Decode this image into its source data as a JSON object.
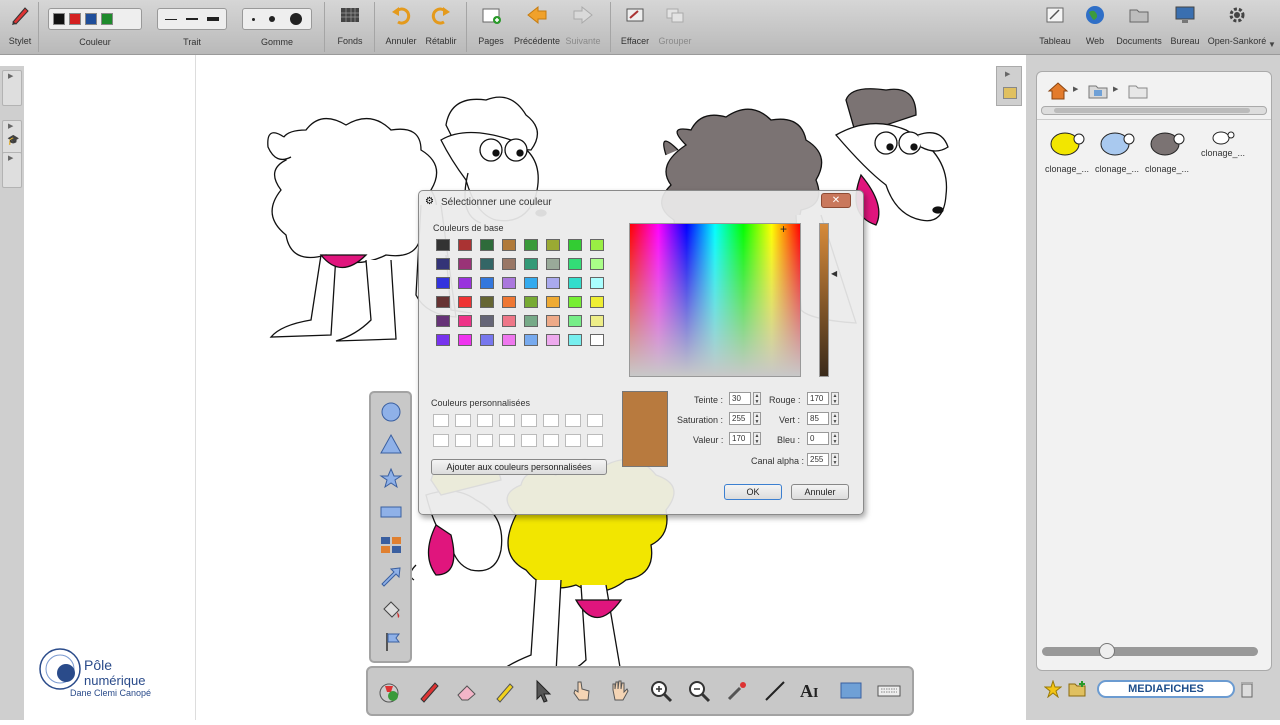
{
  "toolbar": {
    "stylet": "Stylet",
    "couleur": "Couleur",
    "trait": "Trait",
    "gomme": "Gomme",
    "fonds": "Fonds",
    "annuler": "Annuler",
    "retablir": "Rétablir",
    "pages": "Pages",
    "precedente": "Précédente",
    "suivante": "Suivante",
    "effacer": "Effacer",
    "grouper": "Grouper",
    "tableau": "Tableau",
    "web": "Web",
    "documents": "Documents",
    "bureau": "Bureau",
    "open_sankore": "Open-Sankoré",
    "colors": [
      "#111111",
      "#d42020",
      "#1f4e9a",
      "#1e8a2c"
    ]
  },
  "library": {
    "items": [
      {
        "label": "clonage_...",
        "color": "#f2e600"
      },
      {
        "label": "clonage_...",
        "color": "#a9c9ef"
      },
      {
        "label": "clonage_...",
        "color": "#7b7373"
      },
      {
        "label": "clonage_...",
        "color": "#ffffff"
      }
    ],
    "mediafiches": "MEDIAFICHES"
  },
  "dialog": {
    "title": "Sélectionner une couleur",
    "basic_colors_label": "Couleurs de base",
    "custom_colors_label": "Couleurs personnalisées",
    "add_custom_button": "Ajouter aux couleurs personnalisées",
    "hue_label": "Teinte :",
    "hue": "30",
    "saturation_label": "Saturation :",
    "saturation": "255",
    "value_label": "Valeur :",
    "value": "170",
    "red_label": "Rouge :",
    "red": "170",
    "green_label": "Vert :",
    "green": "85",
    "blue_label": "Bleu :",
    "blue": "0",
    "alpha_label": "Canal alpha :",
    "alpha": "255",
    "ok_button": "OK",
    "cancel_button": "Annuler",
    "current_color": "#b87a3e",
    "basic_colors": [
      "#333333",
      "#aa3333",
      "#2e6b3a",
      "#b07a3a",
      "#3a9a3a",
      "#9aaa33",
      "#33cc33",
      "#99ee44",
      "#333377",
      "#993377",
      "#336666",
      "#997766",
      "#339977",
      "#99aa99",
      "#33dd77",
      "#aaff88",
      "#3333dd",
      "#9933dd",
      "#3377dd",
      "#aa77dd",
      "#33aaee",
      "#aaaaee",
      "#33ddcc",
      "#aaffff",
      "#663333",
      "#ee3333",
      "#666633",
      "#ee7733",
      "#77aa33",
      "#eeaa33",
      "#77ee33",
      "#eeee33",
      "#663377",
      "#ee3388",
      "#666677",
      "#ee7788",
      "#77aa88",
      "#eeaa88",
      "#77ee88",
      "#eeee88",
      "#7733ee",
      "#ee33ee",
      "#7777ee",
      "#ee77ee",
      "#77aaee",
      "#eeaaee",
      "#77eeee",
      "#ffffff"
    ]
  },
  "logo": {
    "title": "Pôle",
    "subtitle": "numérique",
    "tagline": "Dane Clemi Canopé"
  }
}
